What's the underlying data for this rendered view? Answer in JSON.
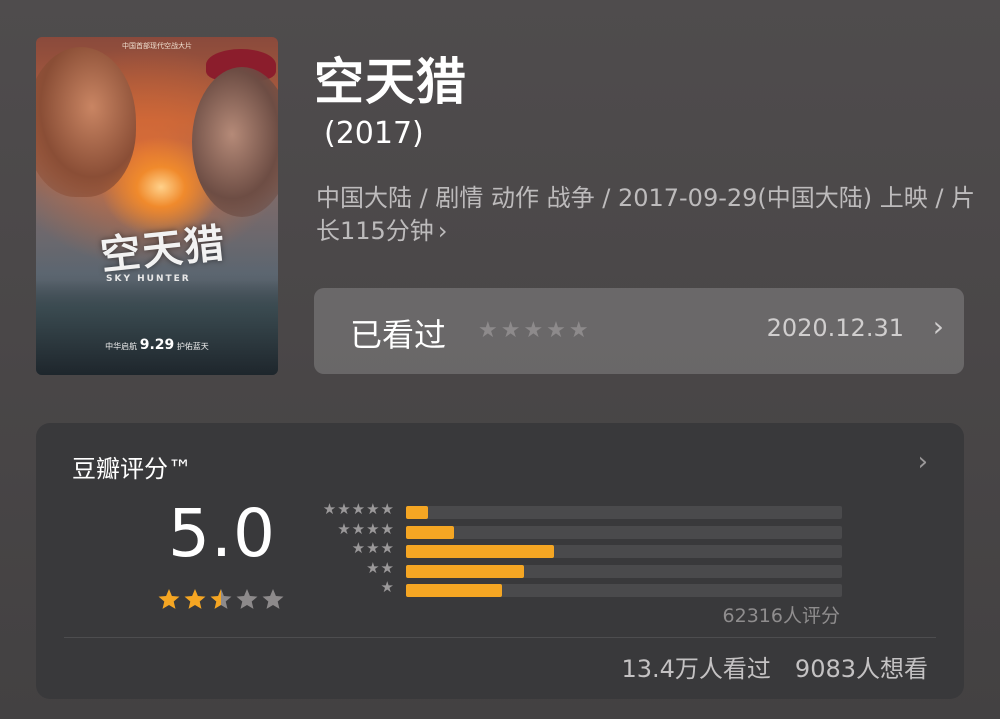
{
  "poster": {
    "top_text": "中国首部现代空战大片",
    "art_title": "空天猎",
    "art_title_en": "SKY HUNTER",
    "release_prefix": "中华启航",
    "release_date": "9.29",
    "release_suffix": "护佑蓝天"
  },
  "movie": {
    "title": "空天猎",
    "year": "(2017)",
    "meta": "中国大陆 / 剧情 动作 战争 / 2017-09-29(中国大陆) 上映 / 片长115分钟",
    "meta_chevron": "›"
  },
  "watched": {
    "label": "已看过",
    "stars": "★★★★★",
    "date": "2020.12.31",
    "chevron": "›"
  },
  "rating": {
    "header": "豆瓣评分™",
    "header_chevron": "›",
    "score": "5.0",
    "score_stars_value": 2.5,
    "score_stars_max": 5,
    "distribution": [
      {
        "stars": "★★★★★",
        "fraction": 0.05
      },
      {
        "stars": "★★★★",
        "fraction": 0.11
      },
      {
        "stars": "★★★",
        "fraction": 0.34
      },
      {
        "stars": "★★",
        "fraction": 0.27
      },
      {
        "stars": "★",
        "fraction": 0.22
      }
    ],
    "count": "62316人评分",
    "watched_count": "13.4万人看过",
    "want_count": "9083人想看"
  },
  "colors": {
    "star_gold": "#f5a623",
    "star_gray": "#8d8a8b",
    "bar_fill": "#f5a623",
    "bar_track": "#4a4a4c"
  }
}
